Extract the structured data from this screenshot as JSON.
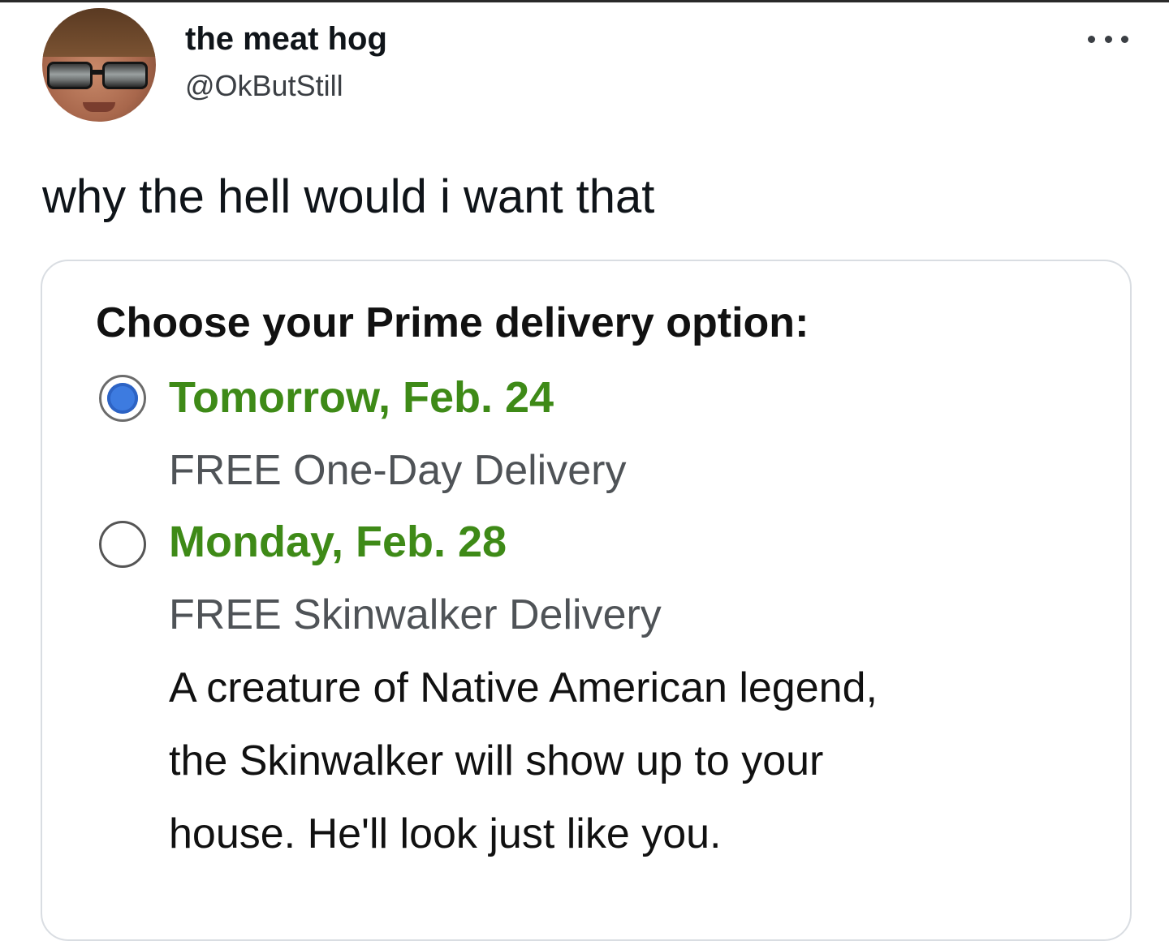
{
  "tweet": {
    "display_name": "the meat hog",
    "handle": "@OkButStill",
    "text": "why the hell would i want that",
    "more_icon": "ellipsis-icon",
    "avatar_icon": "avatar-sunglasses"
  },
  "card": {
    "title": "Choose your Prime delivery option:",
    "options": [
      {
        "date": "Tomorrow, Feb. 24",
        "type": "FREE One-Day Delivery",
        "selected": true
      },
      {
        "date": "Monday, Feb. 28",
        "type": "FREE Skinwalker Delivery",
        "selected": false,
        "description_lines": [
          "A creature of Native American legend,",
          "the Skinwalker will show up to your",
          "house. He'll look just like you."
        ]
      }
    ]
  },
  "colors": {
    "date_green": "#3e8a17",
    "radio_blue": "#3d7be0",
    "secondary_text": "#4f5357"
  }
}
